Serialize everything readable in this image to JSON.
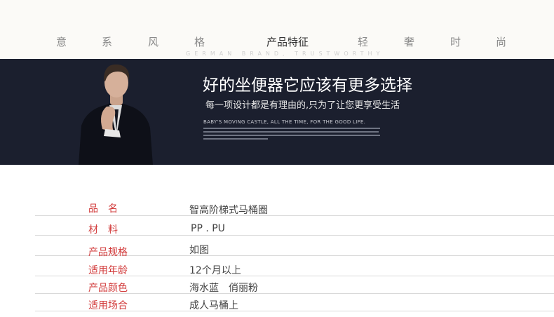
{
  "nav": {
    "items": [
      "意",
      "系",
      "风",
      "格",
      "产品特征",
      "轻",
      "奢",
      "时",
      "尚"
    ],
    "subtitle": "GERMAN BRAND, TRUSTWORTHY"
  },
  "banner": {
    "headline": "好的坐便器它应该有更多选择",
    "subline": "每一项设计都是有理由的,只为了让您更享受生活",
    "english": "BABY'S MOVING CASTLE, ALL THE TIME, FOR THE GOOD LIFE."
  },
  "specs": [
    {
      "label": "品　名",
      "value": "智高阶梯式马桶圈"
    },
    {
      "label": "材　料",
      "value": "PP . PU"
    },
    {
      "label": "产品规格",
      "value": "如图"
    },
    {
      "label": "适用年龄",
      "value": "12个月以上"
    },
    {
      "label": "产品颜色",
      "value": "海水蓝　俏丽粉"
    },
    {
      "label": "适用场合",
      "value": "成人马桶上"
    }
  ],
  "colors": {
    "banner_bg": "#1b1f2e",
    "label_red": "#d23b3b",
    "top_bg": "#fbfaf7"
  }
}
